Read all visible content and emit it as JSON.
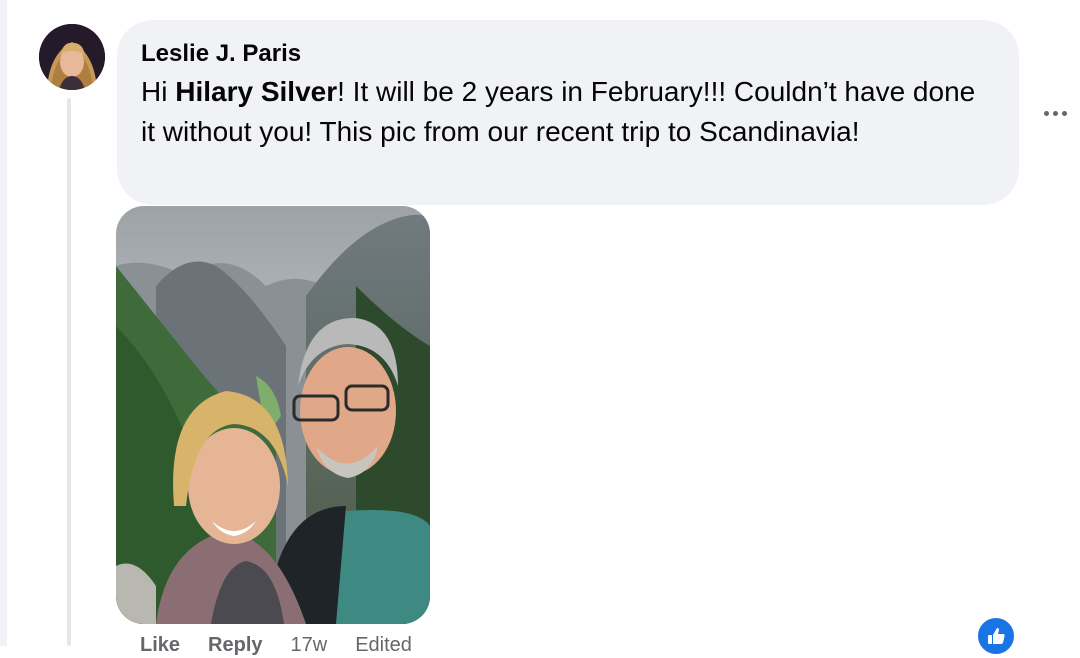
{
  "comment": {
    "author": "Leslie J. Paris",
    "text_before": "Hi ",
    "mention": "Hilary Silver",
    "text_after": "! It will be 2 years in February!!! Couldn’t have done it without you! This pic from our recent trip to Scandinavia!",
    "avatar_icon": "profile-photo",
    "more_icon": "more-options-icon"
  },
  "footer": {
    "like_label": "Like",
    "reply_label": "Reply",
    "time": "17w",
    "edited": "Edited"
  },
  "reactions": {
    "icon": "thumbs-up-icon",
    "color": "#1b74e4"
  },
  "colors": {
    "bubble": "#f0f2f5",
    "secondary_text": "#65676b",
    "thread_line": "#e4e6eb"
  }
}
